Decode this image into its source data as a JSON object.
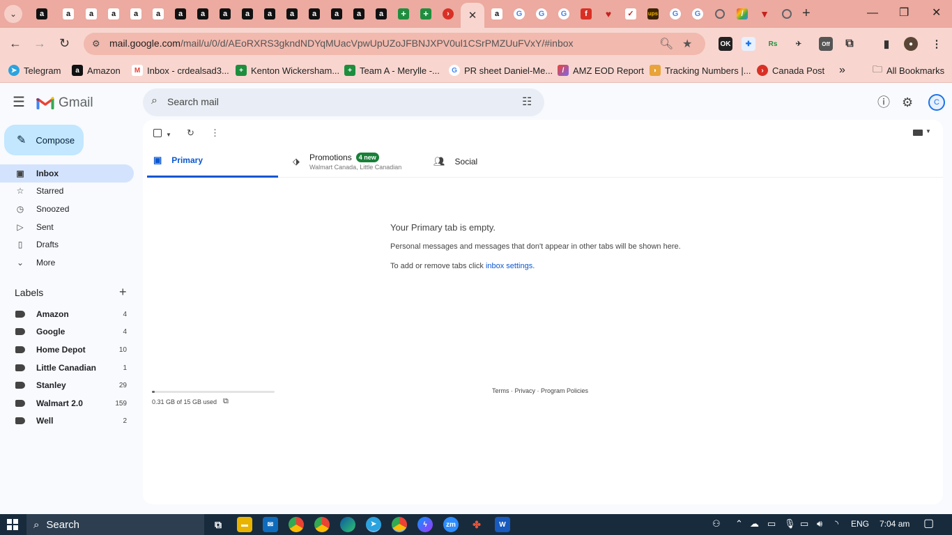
{
  "browser": {
    "active_tab_close": "✕",
    "new_tab": "+",
    "address": {
      "host": "mail.google.com",
      "path": "/mail/u/0/d/AEoRXRS3gkndNDYqMUacVpwUpUZoJFBNJXPV0ul1CSrPMZUuFVxY/#inbox"
    },
    "bookmarks": [
      {
        "label": "Telegram",
        "icon": "telegram-icon",
        "color": "#2aa3df"
      },
      {
        "label": "Amazon",
        "icon": "amazon-icon",
        "color": "#111111"
      },
      {
        "label": "Inbox - crdealsad3...",
        "icon": "gmail-icon",
        "color": "#ea4335"
      },
      {
        "label": "Kenton Wickersham...",
        "icon": "sheets-icon",
        "color": "#1e8e3e"
      },
      {
        "label": "Team A - Merylle -...",
        "icon": "sheets-icon",
        "color": "#1e8e3e"
      },
      {
        "label": "PR sheet Daniel-Me...",
        "icon": "google-icon",
        "color": "#4285f4"
      },
      {
        "label": "AMZ EOD Report",
        "icon": "clickup-icon",
        "color": "#7b68ee"
      },
      {
        "label": "Tracking Numbers |...",
        "icon": "taco-icon",
        "color": "#e8a33a"
      },
      {
        "label": "Canada Post",
        "icon": "canada-post-icon",
        "color": "#d93025"
      }
    ],
    "bookmarks_more": "»",
    "all_bookmarks": "All Bookmarks"
  },
  "gmail": {
    "product": "Gmail",
    "search_placeholder": "Search mail",
    "avatar_letter": "C",
    "compose": "Compose",
    "nav": [
      {
        "label": "Inbox",
        "icon": "inbox-icon",
        "active": true
      },
      {
        "label": "Starred",
        "icon": "star-icon"
      },
      {
        "label": "Snoozed",
        "icon": "clock-icon"
      },
      {
        "label": "Sent",
        "icon": "send-icon"
      },
      {
        "label": "Drafts",
        "icon": "draft-icon"
      },
      {
        "label": "More",
        "icon": "chevron-down-icon"
      }
    ],
    "labels_title": "Labels",
    "labels": [
      {
        "name": "Amazon",
        "count": "4"
      },
      {
        "name": "Google",
        "count": "4"
      },
      {
        "name": "Home Depot",
        "count": "10"
      },
      {
        "name": "Little Canadian",
        "count": "1"
      },
      {
        "name": "Stanley",
        "count": "29"
      },
      {
        "name": "Walmart 2.0",
        "count": "159"
      },
      {
        "name": "Well",
        "count": "2"
      }
    ],
    "tabs": {
      "primary": "Primary",
      "promotions": "Promotions",
      "promotions_badge": "4 new",
      "promotions_senders": "Walmart Canada, Little Canadian",
      "social": "Social"
    },
    "empty": {
      "title": "Your Primary tab is empty.",
      "description": "Personal messages and messages that don't appear in other tabs will be shown here.",
      "hint_prefix": "To add or remove tabs click ",
      "hint_link": "inbox settings",
      "hint_suffix": "."
    },
    "storage": {
      "text": "0.31 GB of 15 GB used",
      "used_fraction": 0.02
    },
    "footer": "Terms · Privacy · Program Policies"
  },
  "taskbar": {
    "search": "Search",
    "language": "ENG",
    "time": "7:04 am"
  }
}
